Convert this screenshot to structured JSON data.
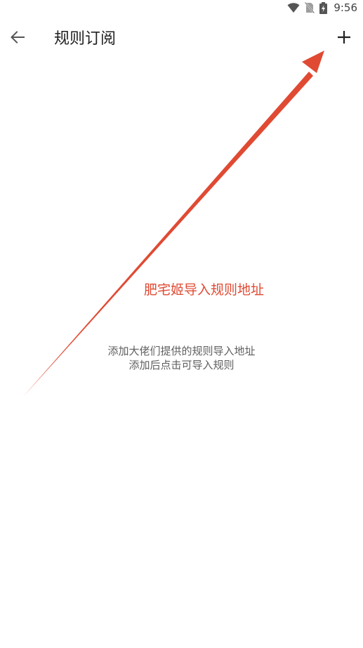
{
  "status_bar": {
    "time": "9:56",
    "icons": [
      "wifi-icon",
      "no-sim-icon",
      "battery-charging-icon"
    ]
  },
  "app_bar": {
    "title": "规则订阅",
    "back_icon": "arrow-left-icon",
    "add_icon": "plus-icon"
  },
  "annotation": {
    "text": "肥宅姬导入规则地址",
    "color": "#e04a33"
  },
  "empty_state": {
    "line1": "添加大佬们提供的规则导入地址",
    "line2": "添加后点击可导入规则"
  },
  "colors": {
    "accent_annotation": "#e04a33",
    "text_primary": "#212121",
    "text_secondary": "#5f5f5f",
    "background": "#ffffff"
  }
}
